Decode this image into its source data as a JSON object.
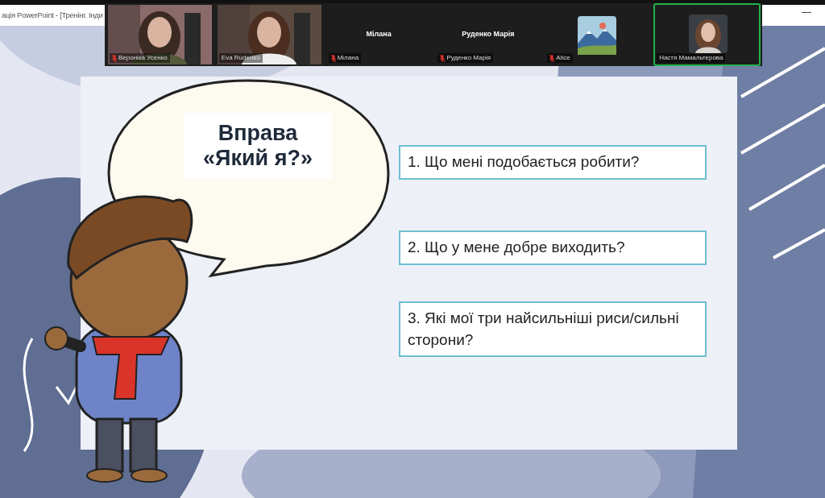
{
  "app_title": "ація PowerPoint - [Тренінг. Інди",
  "participants": [
    {
      "kind": "video",
      "name": "Вероніка Усенко",
      "muted": true,
      "selected": false
    },
    {
      "kind": "video",
      "name": "Eva Rudenko",
      "muted": false,
      "selected": false
    },
    {
      "kind": "name",
      "center_name": "Мілана",
      "name": "Мілана",
      "muted": true,
      "selected": false
    },
    {
      "kind": "name",
      "center_name": "Руденко Марія",
      "name": "Руденко Марія",
      "muted": true,
      "selected": false
    },
    {
      "kind": "avatar",
      "name": "Alice",
      "muted": true,
      "selected": false
    },
    {
      "name": "Настя Мамальтерова",
      "muted": false,
      "selected": true
    }
  ],
  "slide": {
    "title_lines": [
      "Вправа",
      "«Який я?»"
    ],
    "questions": [
      "1. Що мені подобається робити?",
      "2. Що у мене добре виходить?",
      "3. Які мої три найсильніші риси/сильні сторони?"
    ]
  }
}
